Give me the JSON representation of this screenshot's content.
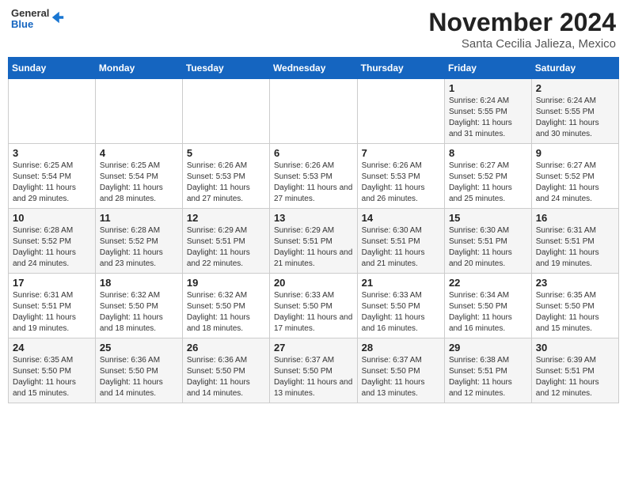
{
  "header": {
    "logo_general": "General",
    "logo_blue": "Blue",
    "title": "November 2024",
    "subtitle": "Santa Cecilia Jalieza, Mexico"
  },
  "days_of_week": [
    "Sunday",
    "Monday",
    "Tuesday",
    "Wednesday",
    "Thursday",
    "Friday",
    "Saturday"
  ],
  "weeks": [
    [
      {
        "day": "",
        "detail": ""
      },
      {
        "day": "",
        "detail": ""
      },
      {
        "day": "",
        "detail": ""
      },
      {
        "day": "",
        "detail": ""
      },
      {
        "day": "",
        "detail": ""
      },
      {
        "day": "1",
        "detail": "Sunrise: 6:24 AM\nSunset: 5:55 PM\nDaylight: 11 hours and 31 minutes."
      },
      {
        "day": "2",
        "detail": "Sunrise: 6:24 AM\nSunset: 5:55 PM\nDaylight: 11 hours and 30 minutes."
      }
    ],
    [
      {
        "day": "3",
        "detail": "Sunrise: 6:25 AM\nSunset: 5:54 PM\nDaylight: 11 hours and 29 minutes."
      },
      {
        "day": "4",
        "detail": "Sunrise: 6:25 AM\nSunset: 5:54 PM\nDaylight: 11 hours and 28 minutes."
      },
      {
        "day": "5",
        "detail": "Sunrise: 6:26 AM\nSunset: 5:53 PM\nDaylight: 11 hours and 27 minutes."
      },
      {
        "day": "6",
        "detail": "Sunrise: 6:26 AM\nSunset: 5:53 PM\nDaylight: 11 hours and 27 minutes."
      },
      {
        "day": "7",
        "detail": "Sunrise: 6:26 AM\nSunset: 5:53 PM\nDaylight: 11 hours and 26 minutes."
      },
      {
        "day": "8",
        "detail": "Sunrise: 6:27 AM\nSunset: 5:52 PM\nDaylight: 11 hours and 25 minutes."
      },
      {
        "day": "9",
        "detail": "Sunrise: 6:27 AM\nSunset: 5:52 PM\nDaylight: 11 hours and 24 minutes."
      }
    ],
    [
      {
        "day": "10",
        "detail": "Sunrise: 6:28 AM\nSunset: 5:52 PM\nDaylight: 11 hours and 24 minutes."
      },
      {
        "day": "11",
        "detail": "Sunrise: 6:28 AM\nSunset: 5:52 PM\nDaylight: 11 hours and 23 minutes."
      },
      {
        "day": "12",
        "detail": "Sunrise: 6:29 AM\nSunset: 5:51 PM\nDaylight: 11 hours and 22 minutes."
      },
      {
        "day": "13",
        "detail": "Sunrise: 6:29 AM\nSunset: 5:51 PM\nDaylight: 11 hours and 21 minutes."
      },
      {
        "day": "14",
        "detail": "Sunrise: 6:30 AM\nSunset: 5:51 PM\nDaylight: 11 hours and 21 minutes."
      },
      {
        "day": "15",
        "detail": "Sunrise: 6:30 AM\nSunset: 5:51 PM\nDaylight: 11 hours and 20 minutes."
      },
      {
        "day": "16",
        "detail": "Sunrise: 6:31 AM\nSunset: 5:51 PM\nDaylight: 11 hours and 19 minutes."
      }
    ],
    [
      {
        "day": "17",
        "detail": "Sunrise: 6:31 AM\nSunset: 5:51 PM\nDaylight: 11 hours and 19 minutes."
      },
      {
        "day": "18",
        "detail": "Sunrise: 6:32 AM\nSunset: 5:50 PM\nDaylight: 11 hours and 18 minutes."
      },
      {
        "day": "19",
        "detail": "Sunrise: 6:32 AM\nSunset: 5:50 PM\nDaylight: 11 hours and 18 minutes."
      },
      {
        "day": "20",
        "detail": "Sunrise: 6:33 AM\nSunset: 5:50 PM\nDaylight: 11 hours and 17 minutes."
      },
      {
        "day": "21",
        "detail": "Sunrise: 6:33 AM\nSunset: 5:50 PM\nDaylight: 11 hours and 16 minutes."
      },
      {
        "day": "22",
        "detail": "Sunrise: 6:34 AM\nSunset: 5:50 PM\nDaylight: 11 hours and 16 minutes."
      },
      {
        "day": "23",
        "detail": "Sunrise: 6:35 AM\nSunset: 5:50 PM\nDaylight: 11 hours and 15 minutes."
      }
    ],
    [
      {
        "day": "24",
        "detail": "Sunrise: 6:35 AM\nSunset: 5:50 PM\nDaylight: 11 hours and 15 minutes."
      },
      {
        "day": "25",
        "detail": "Sunrise: 6:36 AM\nSunset: 5:50 PM\nDaylight: 11 hours and 14 minutes."
      },
      {
        "day": "26",
        "detail": "Sunrise: 6:36 AM\nSunset: 5:50 PM\nDaylight: 11 hours and 14 minutes."
      },
      {
        "day": "27",
        "detail": "Sunrise: 6:37 AM\nSunset: 5:50 PM\nDaylight: 11 hours and 13 minutes."
      },
      {
        "day": "28",
        "detail": "Sunrise: 6:37 AM\nSunset: 5:50 PM\nDaylight: 11 hours and 13 minutes."
      },
      {
        "day": "29",
        "detail": "Sunrise: 6:38 AM\nSunset: 5:51 PM\nDaylight: 11 hours and 12 minutes."
      },
      {
        "day": "30",
        "detail": "Sunrise: 6:39 AM\nSunset: 5:51 PM\nDaylight: 11 hours and 12 minutes."
      }
    ]
  ]
}
